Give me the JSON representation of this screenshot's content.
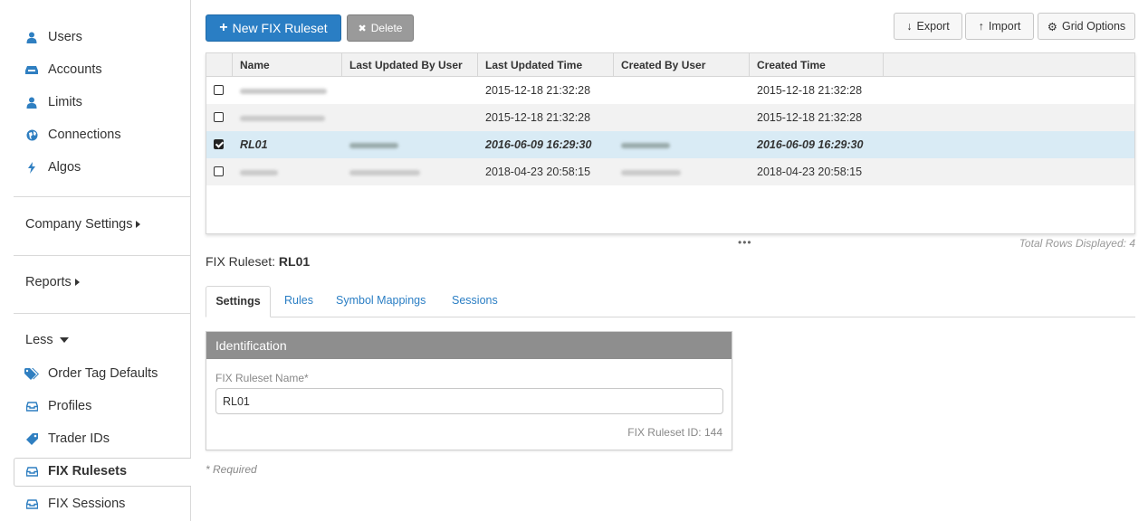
{
  "sidebar": {
    "items": [
      {
        "label": "Users",
        "icon": "user-icon"
      },
      {
        "label": "Accounts",
        "icon": "inbox-icon"
      },
      {
        "label": "Limits",
        "icon": "user-icon"
      },
      {
        "label": "Connections",
        "icon": "globe-icon"
      },
      {
        "label": "Algos",
        "icon": "bolt-icon"
      }
    ],
    "company_settings": "Company Settings",
    "reports": "Reports",
    "less": "Less",
    "more_items": [
      {
        "label": "Order Tag Defaults",
        "icon": "tags-icon"
      },
      {
        "label": "Profiles",
        "icon": "tray-icon"
      },
      {
        "label": "Trader IDs",
        "icon": "tag-icon"
      },
      {
        "label": "FIX Rulesets",
        "icon": "tray-icon",
        "active": true
      },
      {
        "label": "FIX Sessions",
        "icon": "tray-icon"
      }
    ]
  },
  "toolbar": {
    "new_label": "New FIX Ruleset",
    "delete_label": "Delete",
    "export_label": "Export",
    "import_label": "Import",
    "grid_options_label": "Grid Options"
  },
  "grid": {
    "columns": [
      "Name",
      "Last Updated By User",
      "Last Updated Time",
      "Created By User",
      "Created Time"
    ],
    "rows": [
      {
        "checked": false,
        "name": "",
        "updated_by": "",
        "updated_time": "2015-12-18 21:32:28",
        "created_by": "",
        "created_time": "2015-12-18 21:32:28",
        "selected": false
      },
      {
        "checked": false,
        "name": "",
        "updated_by": "",
        "updated_time": "2015-12-18 21:32:28",
        "created_by": "",
        "created_time": "2015-12-18 21:32:28",
        "selected": false
      },
      {
        "checked": true,
        "name": "RL01",
        "updated_by": "",
        "updated_time": "2016-06-09 16:29:30",
        "created_by": "",
        "created_time": "2016-06-09 16:29:30",
        "selected": true
      },
      {
        "checked": false,
        "name": "",
        "updated_by": "",
        "updated_time": "2018-04-23 20:58:15",
        "created_by": "",
        "created_time": "2018-04-23 20:58:15",
        "selected": false
      }
    ],
    "total_rows": "Total Rows Displayed: 4"
  },
  "detail": {
    "title_prefix": "FIX Ruleset:",
    "title_value": "RL01",
    "tabs": [
      "Settings",
      "Rules",
      "Symbol Mappings",
      "Sessions"
    ],
    "panel_title": "Identification",
    "name_label": "FIX Ruleset Name*",
    "name_value": "RL01",
    "ruleset_id": "FIX Ruleset ID: 144",
    "required_note": "* Required"
  },
  "colors": {
    "primary": "#2a7ec4",
    "selected_row": "#d9ebf5",
    "panel_header": "#8e8e8e"
  }
}
